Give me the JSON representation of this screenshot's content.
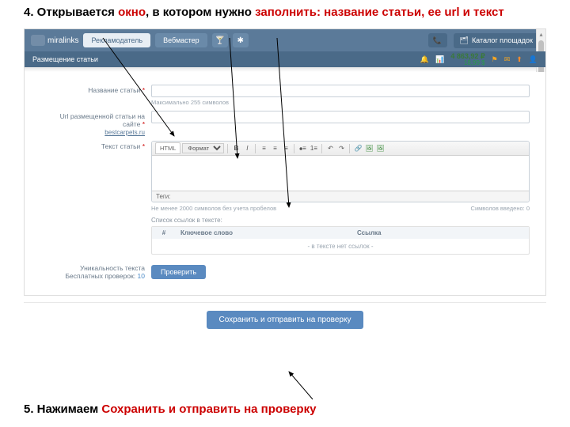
{
  "instruction4": {
    "prefix": "4. Открывается ",
    "w1": "окно",
    "mid1": ", в котором нужно ",
    "w2": "заполнить: название статьи, ее url и текст"
  },
  "instruction5": {
    "prefix": "5. Нажимаем ",
    "action": "Сохранить и отправить на проверку"
  },
  "header": {
    "logo": "miralinks",
    "nav1": "Рекламодатель",
    "nav2": "Вебмастер",
    "catalog": "Каталог площадок"
  },
  "subbar": {
    "title": "Размещение статьи",
    "balance_rub": "4 863,92 ₽",
    "balance_usd": "18,99 $"
  },
  "form": {
    "title_label": "Название статьи",
    "title_hint": "Максимально 255 символов",
    "url_label": "Url размещенной статьи на сайте",
    "url_link": "bestcarpets.ru",
    "text_label": "Текст статьи",
    "editor_tab": "HTML",
    "editor_format": "Формат",
    "editor_tags": "Теги:",
    "below_min": "Не менее 2000 символов без учета пробелов",
    "below_count_label": "Символов введено:",
    "below_count_val": "0",
    "links_title": "Список ссылок в тексте:",
    "links_col_num": "#",
    "links_col_key": "Ключевое слово",
    "links_col_url": "Ссылка",
    "links_empty": "- в тексте нет ссылок -",
    "unique_label": "Уникальность текста",
    "unique_free_label": "Бесплатных проверок:",
    "unique_free_val": "10",
    "check_btn": "Проверить",
    "submit": "Сохранить и отправить на проверку"
  }
}
